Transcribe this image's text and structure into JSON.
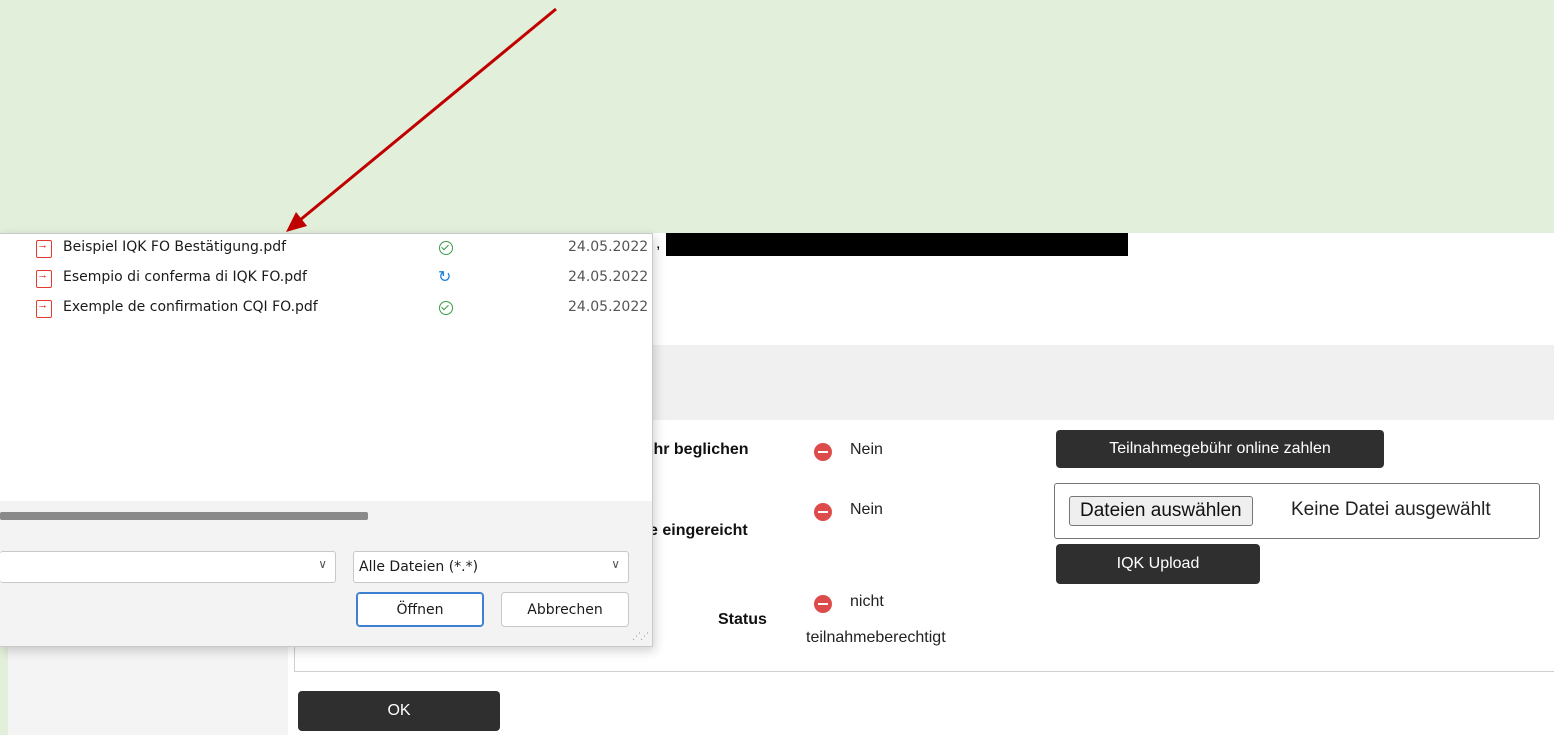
{
  "dialog": {
    "files": [
      {
        "name": "Beispiel IQK FO Bestätigung.pdf",
        "status_icon": "synced-check-icon",
        "date": "24.05.2022"
      },
      {
        "name": "Esempio di conferma di IQK FO.pdf",
        "status_icon": "syncing-icon",
        "date": "24.05.2022"
      },
      {
        "name": "Exemple de confirmation CQI FO.pdf",
        "status_icon": "synced-check-icon",
        "date": "24.05.2022"
      }
    ],
    "filename_value": "",
    "filetype_value": "Alle Dateien (*.*)",
    "open_label": "Öffnen",
    "cancel_label": "Abbrechen"
  },
  "page": {
    "comma": ",",
    "fee_label_partial": "ihr beglichen",
    "fee_value": "Nein",
    "pay_button": "Teilnahmegebühr online zahlen",
    "iqk_label_partial": "e eingereicht",
    "iqk_value": "Nein",
    "file_button": "Dateien auswählen",
    "file_none": "Keine Datei ausgewählt",
    "upload_button": "IQK Upload",
    "status_label": "Status",
    "status_value_line1": "nicht",
    "status_value_line2": "teilnahmeberechtigt",
    "ok_button": "OK"
  },
  "colors": {
    "background": "#e2efda",
    "arrow": "#c00000",
    "dark_button": "#2f2f2f",
    "status_red": "#dd4b4b"
  }
}
